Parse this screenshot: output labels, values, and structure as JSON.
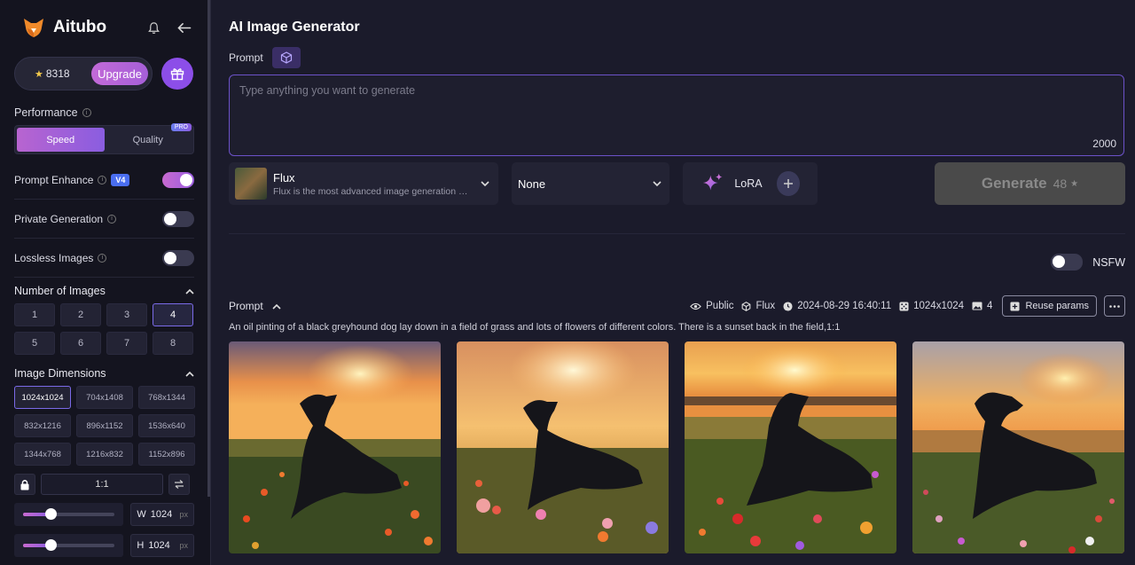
{
  "sidebar": {
    "brand": "Aitubo",
    "credits": "8318",
    "upgrade_label": "Upgrade",
    "performance": {
      "label": "Performance",
      "options": [
        "Speed",
        "Quality"
      ],
      "selected": "Speed",
      "pro_badge": "PRO"
    },
    "prompt_enhance": {
      "label": "Prompt Enhance",
      "badge": "V4",
      "on": true
    },
    "private_generation": {
      "label": "Private Generation",
      "on": false
    },
    "lossless_images": {
      "label": "Lossless Images",
      "on": false
    },
    "number_of_images": {
      "label": "Number of Images",
      "options": [
        "1",
        "2",
        "3",
        "4",
        "5",
        "6",
        "7",
        "8"
      ],
      "selected": "4"
    },
    "image_dimensions": {
      "label": "Image Dimensions",
      "options": [
        "1024x1024",
        "704x1408",
        "768x1344",
        "832x1216",
        "896x1152",
        "1536x640",
        "1344x768",
        "1216x832",
        "1152x896"
      ],
      "selected": "1024x1024",
      "ratio": "1:1"
    },
    "width": {
      "label": "W",
      "value": "1024",
      "unit": "px",
      "fraction": 0.3
    },
    "height": {
      "label": "H",
      "value": "1024",
      "unit": "px",
      "fraction": 0.3
    }
  },
  "main": {
    "title": "AI Image Generator",
    "prompt_label": "Prompt",
    "prompt_placeholder": "Type anything you want to generate",
    "prompt_value": "",
    "char_limit": "2000",
    "model": {
      "name": "Flux",
      "description": "Flux is the most advanced image generation model"
    },
    "style": "None",
    "lora_label": "LoRA",
    "generate": {
      "label": "Generate",
      "cost": "48"
    },
    "nsfw": {
      "label": "NSFW",
      "on": false
    },
    "result": {
      "title": "Prompt",
      "visibility": "Public",
      "model": "Flux",
      "timestamp": "2024-08-29 16:40:11",
      "dimensions": "1024x1024",
      "count": "4",
      "reuse_label": "Reuse params",
      "prompt": "An oil pinting of a black greyhound dog lay down in a field of grass and lots of flowers of different colors. There is a sunset back in the field,1:1",
      "images": [
        "greyhound-sunset-1",
        "greyhound-sunset-2",
        "greyhound-sunset-3",
        "greyhound-sunset-4"
      ]
    }
  }
}
